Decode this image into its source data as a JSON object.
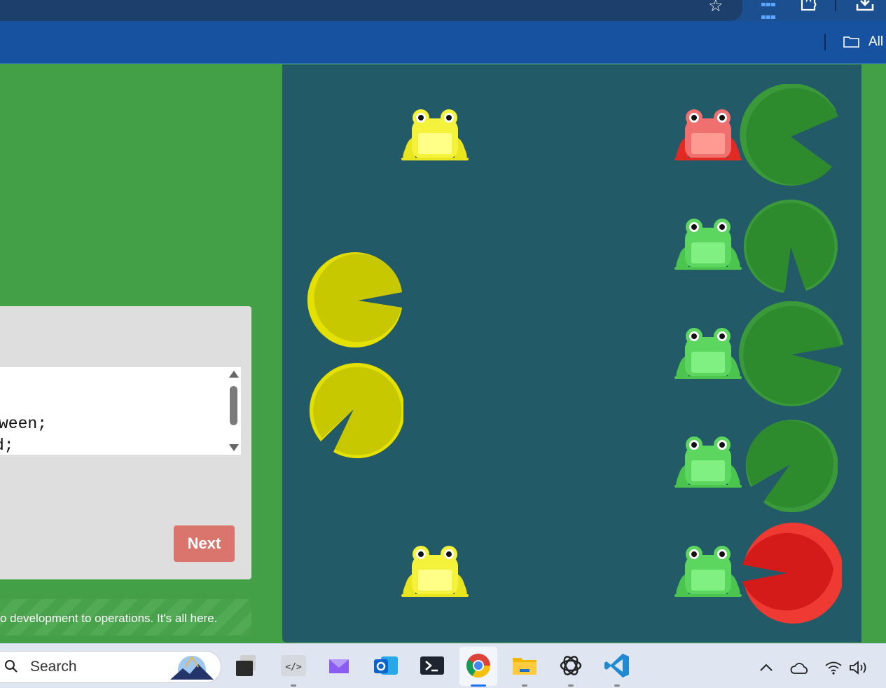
{
  "browser": {
    "bookmarks_all_label": "All",
    "icons": [
      "star-icon",
      "apps-icon",
      "extensions-icon",
      "download-icon",
      "folder-icon"
    ]
  },
  "panel": {
    "code_lines": [
      "ween;",
      "d;"
    ],
    "next_label": "Next",
    "footer_text": "o development to operations. It's all here."
  },
  "pond": {
    "frogs": [
      {
        "color": "yellow",
        "row": 1,
        "column": "left"
      },
      {
        "color": "red",
        "row": 1,
        "column": "right"
      },
      {
        "color": "green",
        "row": 2,
        "column": "right"
      },
      {
        "color": "green",
        "row": 3,
        "column": "right"
      },
      {
        "color": "green",
        "row": 4,
        "column": "right"
      },
      {
        "color": "green",
        "row": 5,
        "column": "right"
      },
      {
        "color": "yellow",
        "row": 5,
        "column": "left"
      }
    ],
    "lilypads": [
      {
        "color": "green",
        "row": 1,
        "column": "far-right"
      },
      {
        "color": "green",
        "row": 2,
        "column": "far-right"
      },
      {
        "color": "green",
        "row": 3,
        "column": "far-right"
      },
      {
        "color": "green",
        "row": 4,
        "column": "far-right"
      },
      {
        "color": "red",
        "row": 5,
        "column": "far-right"
      },
      {
        "color": "yellow",
        "row": "between 2 and 3",
        "column": "left"
      },
      {
        "color": "yellow",
        "row": "between 3 and 4",
        "column": "left"
      }
    ],
    "colors": {
      "water": "#225a68",
      "frog_green": "#5cd65f",
      "frog_yellow": "#f4f23a",
      "frog_red": "#ef3a34",
      "pad_green": "#2d8b2e",
      "pad_yellow": "#c8c800",
      "pad_red": "#d51a1a"
    }
  },
  "taskbar": {
    "search_label": "Search",
    "apps": [
      "task-view-icon",
      "dev-tools-icon",
      "mail-icon",
      "outlook-icon",
      "terminal-icon",
      "chrome-icon",
      "file-explorer-icon",
      "chatgpt-icon",
      "vscode-icon"
    ],
    "tray": [
      "chevron-up-icon",
      "onedrive-icon",
      "wifi-icon",
      "volume-icon"
    ]
  }
}
